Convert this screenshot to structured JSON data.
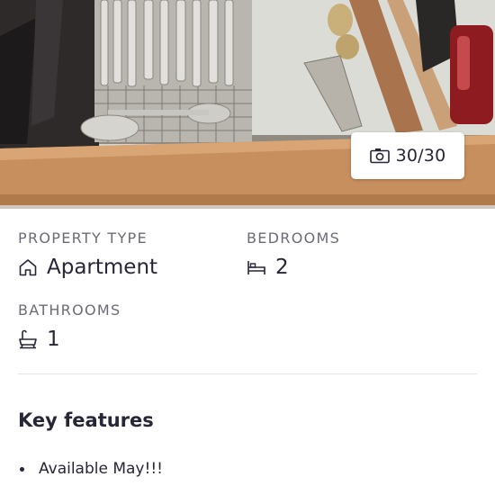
{
  "photo": {
    "counter_text": "30/30",
    "icon": "camera-icon"
  },
  "details": {
    "property_type": {
      "label": "PROPERTY TYPE",
      "value": "Apartment",
      "icon": "house-icon"
    },
    "bedrooms": {
      "label": "BEDROOMS",
      "value": "2",
      "icon": "bed-icon"
    },
    "bathrooms": {
      "label": "BATHROOMS",
      "value": "1",
      "icon": "bath-icon"
    }
  },
  "key_features": {
    "title": "Key features",
    "items": [
      "Available May!!!"
    ]
  }
}
